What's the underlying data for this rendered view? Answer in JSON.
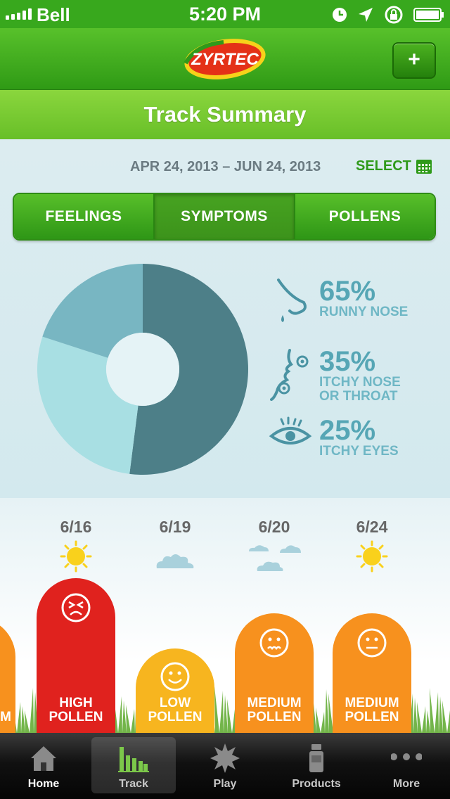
{
  "status_bar": {
    "carrier": "Bell",
    "time": "5:20 PM"
  },
  "nav": {
    "logo_text": "ZYRTEC",
    "add_label": "+"
  },
  "title": "Track Summary",
  "summary": {
    "date_range": "APR 24, 2013 – JUN 24, 2013",
    "select_label": "SELECT",
    "segments": [
      {
        "label": "FEELINGS",
        "active": false
      },
      {
        "label": "SYMPTOMS",
        "active": true
      },
      {
        "label": "POLLENS",
        "active": false
      }
    ],
    "legend": [
      {
        "pct": "65%",
        "label": "RUNNY NOSE",
        "icon": "nose-icon"
      },
      {
        "pct": "35%",
        "label": "ITCHY NOSE\nOR THROAT",
        "icon": "face-profile-icon"
      },
      {
        "pct": "25%",
        "label": "ITCHY EYES",
        "icon": "eye-icon"
      }
    ]
  },
  "chart_data": {
    "type": "pie",
    "categories": [
      "RUNNY NOSE",
      "ITCHY NOSE OR THROAT",
      "ITCHY EYES"
    ],
    "values": [
      65,
      35,
      25
    ],
    "colors": [
      "#4d7f88",
      "#a8dfe3",
      "#78b6c2"
    ]
  },
  "forecast": {
    "days": [
      {
        "date": "6/16",
        "weather": "sun-icon",
        "level": "HIGH\nPOLLEN",
        "color": "#e0221e",
        "face": "angry-face-icon"
      },
      {
        "date": "6/19",
        "weather": "cloud-icon",
        "level": "LOW\nPOLLEN",
        "color": "#f7b51f",
        "face": "smile-face-icon"
      },
      {
        "date": "6/20",
        "weather": "clouds-icon",
        "level": "MEDIUM\nPOLLEN",
        "color": "#f7911e",
        "face": "worried-face-icon"
      },
      {
        "date": "6/24",
        "weather": "sun-icon",
        "level": "MEDIUM\nPOLLEN",
        "color": "#f7911e",
        "face": "neutral-face-icon"
      }
    ],
    "partial_left_label": "M"
  },
  "tabbar": {
    "tabs": [
      {
        "label": "Home",
        "icon": "home-icon"
      },
      {
        "label": "Track",
        "icon": "bar-chart-icon"
      },
      {
        "label": "Play",
        "icon": "starburst-icon"
      },
      {
        "label": "Products",
        "icon": "bottle-icon"
      },
      {
        "label": "More",
        "icon": "more-dots-icon"
      }
    ],
    "active_index": 1
  }
}
